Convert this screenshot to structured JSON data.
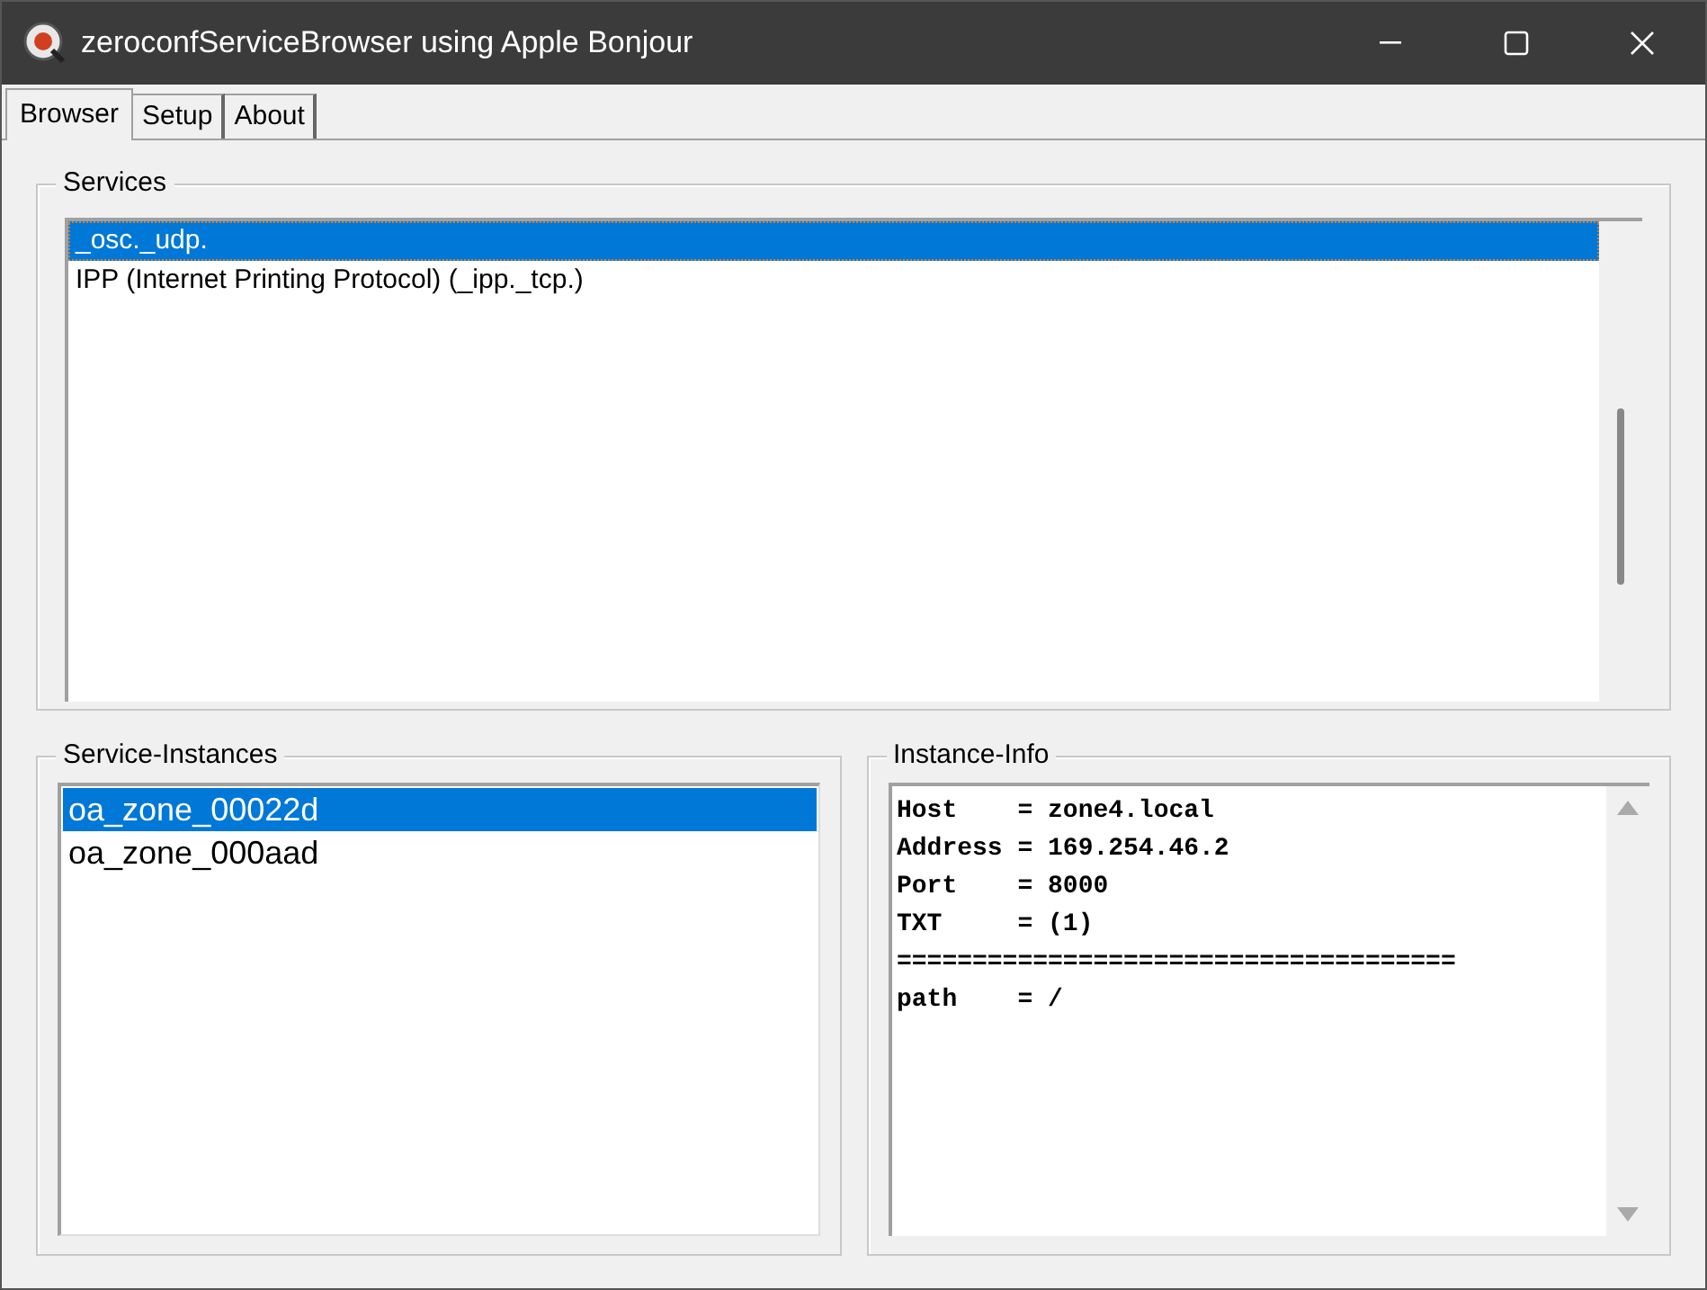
{
  "window": {
    "title": "zeroconfServiceBrowser using Apple Bonjour"
  },
  "tabs": [
    {
      "label": "Browser",
      "selected": true
    },
    {
      "label": "Setup",
      "selected": false
    },
    {
      "label": "About",
      "selected": false
    }
  ],
  "services": {
    "title": "Services",
    "items": [
      {
        "label": "_osc._udp.",
        "selected": true
      },
      {
        "label": "IPP (Internet Printing Protocol) (_ipp._tcp.)",
        "selected": false
      }
    ]
  },
  "service_instances": {
    "title": "Service-Instances",
    "items": [
      {
        "label": "oa_zone_00022d",
        "selected": true
      },
      {
        "label": "oa_zone_000aad",
        "selected": false
      }
    ]
  },
  "instance_info": {
    "title": "Instance-Info",
    "lines": [
      "Host    = zone4.local",
      "Address = 169.254.46.2",
      "Port    = 8000",
      "TXT     = (1)",
      "=====================================",
      "path    = /"
    ]
  }
}
